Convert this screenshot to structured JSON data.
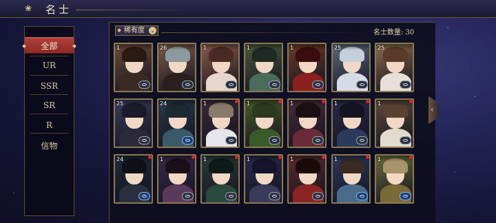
{
  "header": {
    "title": "名士",
    "deco_icon": "cloud-scroll-icon"
  },
  "sidebar": {
    "items": [
      {
        "label": "全部",
        "active": true
      },
      {
        "label": "UR",
        "active": false
      },
      {
        "label": "SSR",
        "active": false
      },
      {
        "label": "SR",
        "active": false
      },
      {
        "label": "R",
        "active": false
      },
      {
        "label": "信物",
        "active": false
      }
    ]
  },
  "toolbar": {
    "sort_label": "稀有度",
    "sort_icon": "chevron-down-icon"
  },
  "count_label": "名士数量: 30",
  "colors": {
    "active_tab": "#a63631",
    "frame_gold": "#8c7a52",
    "new_dot": "#e0232b"
  },
  "cards": [
    {
      "level": "1",
      "bg": "#6b4a3a",
      "hair": "#2a1a14",
      "body": "#3a2a24",
      "badge": "grey",
      "dot": false
    },
    {
      "level": "26",
      "bg": "#7a5a48",
      "hair": "#8c9aa0",
      "body": "#2a2020",
      "badge": "grey",
      "dot": false
    },
    {
      "level": "1",
      "bg": "#8a5a48",
      "hair": "#4a2a24",
      "body": "#e6d6cc",
      "badge": "grey",
      "dot": false
    },
    {
      "level": "1",
      "bg": "#4a5a3a",
      "hair": "#1e2a22",
      "body": "#4a6a5a",
      "badge": "grey",
      "dot": false
    },
    {
      "level": "1",
      "bg": "#6a3a2a",
      "hair": "#3a0e0e",
      "body": "#8a2020",
      "badge": "grey",
      "dot": false
    },
    {
      "level": "25",
      "bg": "#5a6a7a",
      "hair": "#c6d0dc",
      "body": "#d6dce6",
      "badge": "grey",
      "dot": false
    },
    {
      "level": "25",
      "bg": "#8a6a4a",
      "hair": "#5a3a28",
      "body": "#e8e0d6",
      "badge": "grey",
      "dot": false
    },
    {
      "level": "25",
      "bg": "#3a3a5a",
      "hair": "#1a1a2a",
      "body": "#2a2a3a",
      "badge": "grey",
      "dot": false
    },
    {
      "level": "24",
      "bg": "#2a3a4a",
      "hair": "#1a2a30",
      "body": "#3a5a6a",
      "badge": "blue",
      "dot": false
    },
    {
      "level": "1",
      "bg": "#3a2a3a",
      "hair": "#8a7a6a",
      "body": "#e6e6ea",
      "badge": "grey",
      "dot": true
    },
    {
      "level": "1",
      "bg": "#4a5a2a",
      "hair": "#2a3a1a",
      "body": "#3a5a2a",
      "badge": "grey",
      "dot": true
    },
    {
      "level": "1",
      "bg": "#4a2a3a",
      "hair": "#1a1014",
      "body": "#6a2a3a",
      "badge": "grey",
      "dot": true
    },
    {
      "level": "1",
      "bg": "#2a2a4a",
      "hair": "#141420",
      "body": "#2a3a5a",
      "badge": "grey",
      "dot": true
    },
    {
      "level": "1",
      "bg": "#5a4a3a",
      "hair": "#5a4030",
      "body": "#e0dcd0",
      "badge": "grey",
      "dot": true
    },
    {
      "level": "24",
      "bg": "#1e2a3a",
      "hair": "#101018",
      "body": "#2a3040",
      "badge": "blue",
      "dot": true
    },
    {
      "level": "1",
      "bg": "#3a2a4a",
      "hair": "#1a1018",
      "body": "#5a3a5a",
      "badge": "grey",
      "dot": true
    },
    {
      "level": "1",
      "bg": "#2a3a3a",
      "hair": "#0e1a16",
      "body": "#2a4a40",
      "badge": "grey",
      "dot": true
    },
    {
      "level": "1",
      "bg": "#2a2a4a",
      "hair": "#14142a",
      "body": "#3a3a5a",
      "badge": "grey",
      "dot": true
    },
    {
      "level": "1",
      "bg": "#5a2a2a",
      "hair": "#1a0a0a",
      "body": "#8a2424",
      "badge": "grey",
      "dot": true
    },
    {
      "level": "1",
      "bg": "#2a3a5a",
      "hair": "#3a2a24",
      "body": "#4a6a8a",
      "badge": "blue",
      "dot": true
    },
    {
      "level": "1",
      "bg": "#6a6a3a",
      "hair": "#a8946a",
      "body": "#7a6a3a",
      "badge": "blue",
      "dot": true
    }
  ]
}
